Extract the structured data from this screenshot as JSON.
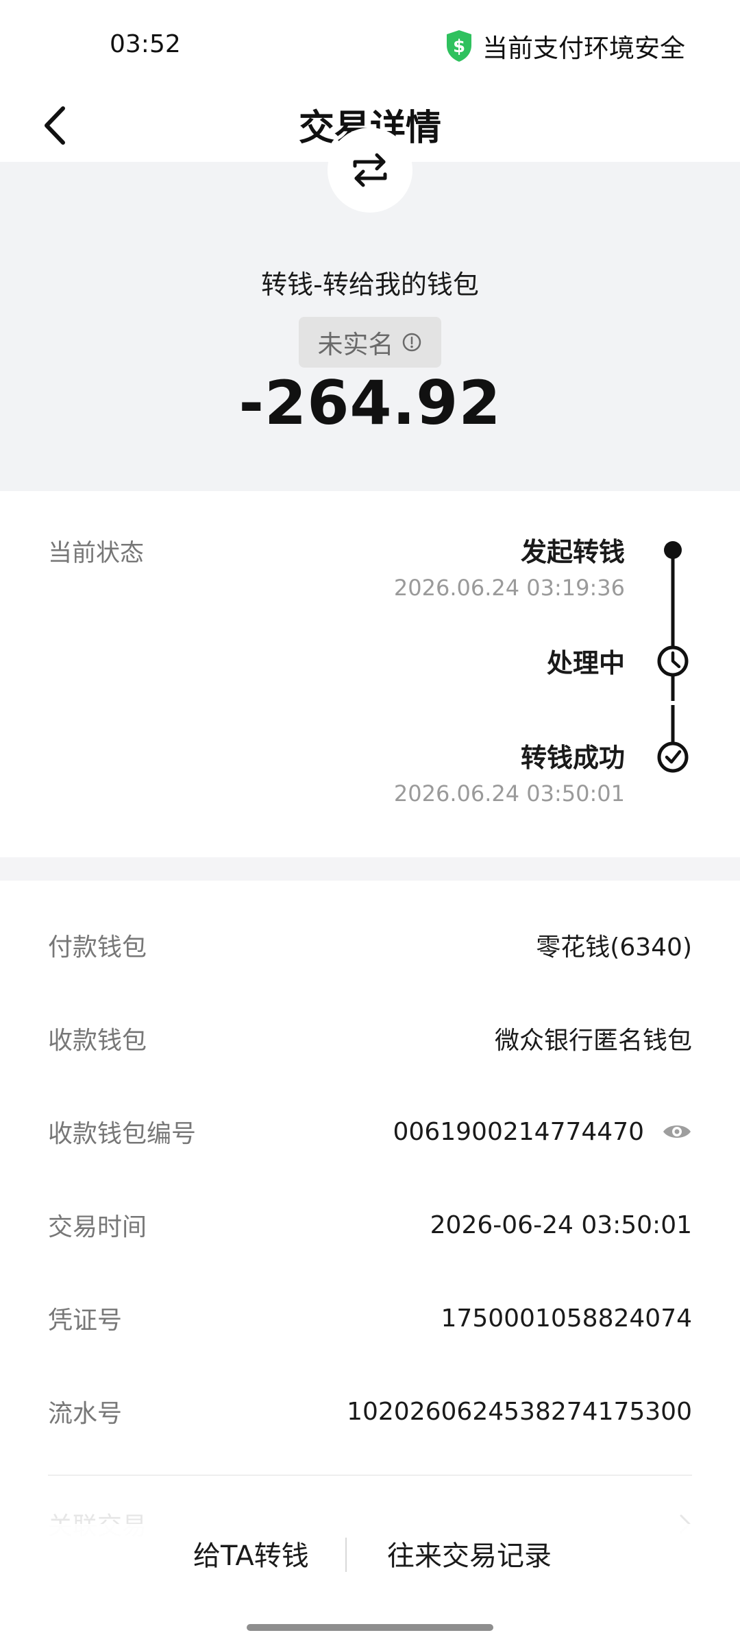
{
  "status_bar": {
    "time": "03:52",
    "security_text": "当前支付环境安全",
    "security_icon": "shield-dollar-icon",
    "security_color": "#2fc15e"
  },
  "header": {
    "title": "交易详情",
    "back_icon": "chevron-left-icon"
  },
  "summary": {
    "type_icon": "transfer-arrows-icon",
    "counterparty": "转钱-转给我的钱包",
    "tag": "未实名",
    "tag_icon": "info-icon",
    "amount": "-264.92"
  },
  "status": {
    "label": "当前状态",
    "steps": [
      {
        "title": "发起转钱",
        "time": "2026.06.24 03:19:36",
        "icon": "dot-icon"
      },
      {
        "title": "处理中",
        "time": "",
        "icon": "clock-icon"
      },
      {
        "title": "转钱成功",
        "time": "2026.06.24 03:50:01",
        "icon": "check-circle-icon"
      }
    ]
  },
  "details": [
    {
      "label": "付款钱包",
      "value": "零花钱(6340)"
    },
    {
      "label": "收款钱包",
      "value": "微众银行匿名钱包"
    },
    {
      "label": "收款钱包编号",
      "value": "0061900214774470",
      "icon": "eye-icon"
    },
    {
      "label": "交易时间",
      "value": "2026-06-24 03:50:01"
    },
    {
      "label": "凭证号",
      "value": "1750001058824074"
    },
    {
      "label": "流水号",
      "value": "10202606245382741753​00"
    }
  ],
  "related": {
    "label": "关联交易",
    "icon": "chevron-right-icon"
  },
  "actions": {
    "transfer_label": "给TA转钱",
    "history_label": "往来交易记录"
  }
}
